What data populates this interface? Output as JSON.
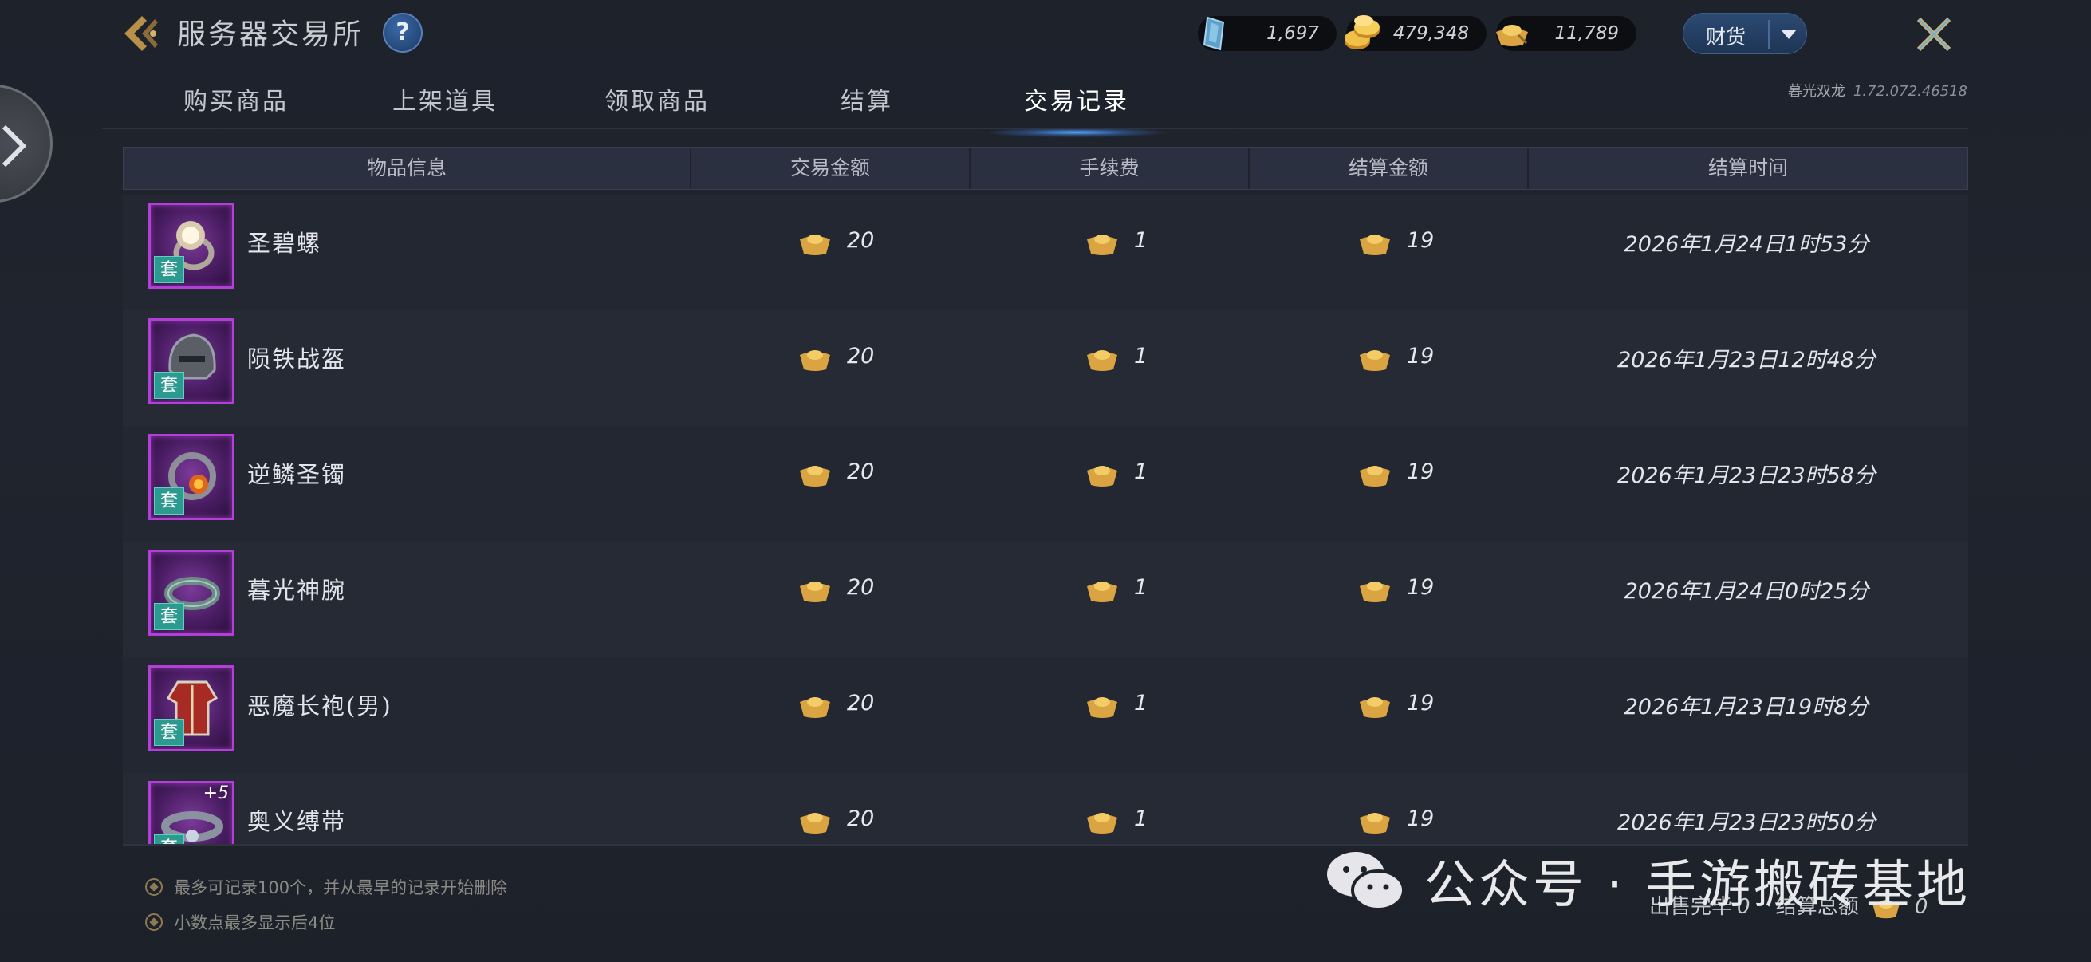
{
  "header": {
    "title": "服务器交易所",
    "help_label": "?",
    "currencies": [
      {
        "icon": "blue-crystal-icon",
        "value": "1,697"
      },
      {
        "icon": "gold-coins-icon",
        "value": "479,348"
      },
      {
        "icon": "gold-ingot-icon",
        "value": "11,789"
      }
    ],
    "filter_label": "财货"
  },
  "tabs": [
    {
      "label": "购买商品",
      "active": false
    },
    {
      "label": "上架道具",
      "active": false
    },
    {
      "label": "领取商品",
      "active": false
    },
    {
      "label": "结算",
      "active": false
    },
    {
      "label": "交易记录",
      "active": true
    }
  ],
  "server": {
    "name": "暮光双龙",
    "version": "1.72.072.46518"
  },
  "table": {
    "columns": [
      "物品信息",
      "交易金额",
      "手续费",
      "结算金额",
      "结算时间"
    ],
    "rows": [
      {
        "name": "圣碧螺",
        "icon": "ring-icon",
        "badge": "套",
        "enhance": "",
        "amount": "20",
        "fee": "1",
        "settle": "19",
        "time": "2026年1月24日1时53分"
      },
      {
        "name": "陨铁战盔",
        "icon": "helmet-icon",
        "badge": "套",
        "enhance": "",
        "amount": "20",
        "fee": "1",
        "settle": "19",
        "time": "2026年1月23日12时48分"
      },
      {
        "name": "逆鳞圣镯",
        "icon": "bracelet-icon",
        "badge": "套",
        "enhance": "",
        "amount": "20",
        "fee": "1",
        "settle": "19",
        "time": "2026年1月23日23时58分"
      },
      {
        "name": "暮光神腕",
        "icon": "bracer-icon",
        "badge": "套",
        "enhance": "",
        "amount": "20",
        "fee": "1",
        "settle": "19",
        "time": "2026年1月24日0时25分"
      },
      {
        "name": "恶魔长袍(男)",
        "icon": "robe-icon",
        "badge": "套",
        "enhance": "",
        "amount": "20",
        "fee": "1",
        "settle": "19",
        "time": "2026年1月23日19时8分"
      },
      {
        "name": "奥义缚带",
        "icon": "belt-icon",
        "badge": "套",
        "enhance": "+5",
        "amount": "20",
        "fee": "1",
        "settle": "19",
        "time": "2026年1月23日23时50分"
      }
    ]
  },
  "footer": {
    "note1": "最多可记录100个，并从最早的记录开始删除",
    "note2": "小数点最多显示后4位",
    "sold_label": "出售完毕",
    "sold_count": "0",
    "total_label": "结算总额",
    "total_value": "0"
  },
  "watermark": {
    "text": "公众号 · 手游搬砖基地"
  },
  "colors": {
    "accent_blue": "#3a6aa8",
    "item_border": "#b43fd8",
    "set_badge": "#2c9a8f",
    "gold": "#d9a441"
  }
}
